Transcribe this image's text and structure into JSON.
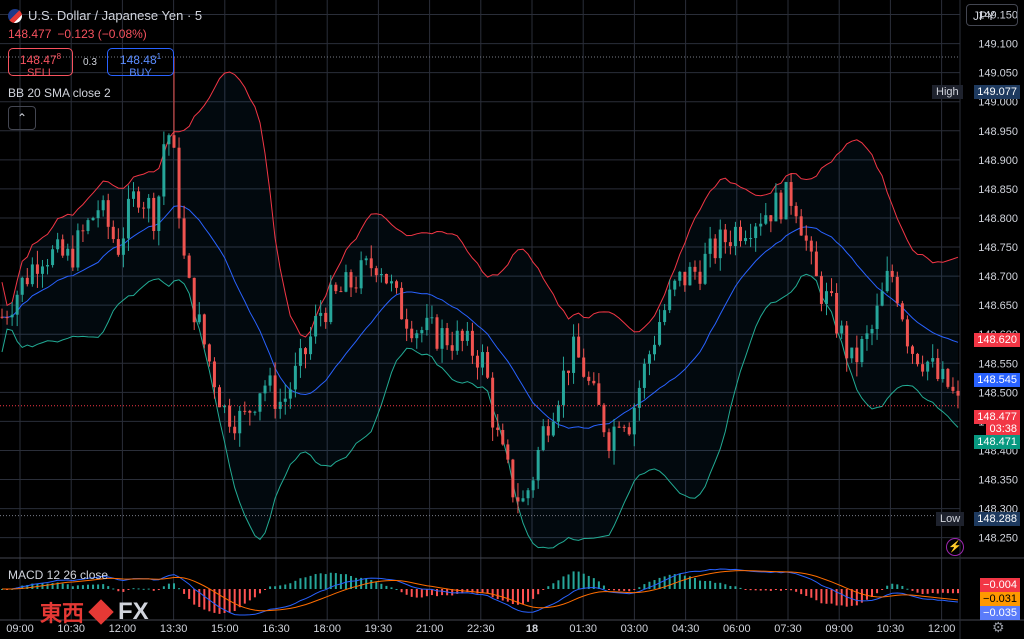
{
  "header": {
    "symbol": "U.S. Dollar / Japanese Yen · 5",
    "last": "148.477",
    "change": "−0.123 (−0.08%)",
    "sell_price_main": "148.47",
    "sell_price_sup": "8",
    "sell_label": "SELL",
    "spread": "0.3",
    "buy_price_main": "148.48",
    "buy_price_sup": "1",
    "buy_label": "BUY",
    "collapse_glyph": "⌃",
    "currency": "JPY"
  },
  "indicators": {
    "bb_label": "BB 20 SMA close 2",
    "macd_label": "MACD 12 26 close"
  },
  "icons": [
    "flag-icon",
    "chevron-up-icon",
    "bolt-icon",
    "gear-icon"
  ],
  "chart_data": {
    "type": "candlestick",
    "title": "U.S. Dollar / Japanese Yen · 5",
    "y_ticks": [
      "149.150",
      "149.100",
      "149.050",
      "149.000",
      "148.950",
      "148.900",
      "148.850",
      "148.800",
      "148.750",
      "148.700",
      "148.650",
      "148.600",
      "148.550",
      "148.500",
      "148.450",
      "148.400",
      "148.350",
      "148.300",
      "148.250"
    ],
    "ylim": [
      148.215,
      149.175
    ],
    "x_ticks": [
      "09:00",
      "10:30",
      "12:00",
      "13:30",
      "15:00",
      "16:30",
      "18:00",
      "19:30",
      "21:00",
      "22:30",
      "18",
      "01:30",
      "03:00",
      "04:30",
      "06:00",
      "07:30",
      "09:00",
      "10:30",
      "12:00"
    ],
    "close_path": [
      [
        0,
        148.63
      ],
      [
        4,
        148.74
      ],
      [
        7,
        148.73
      ],
      [
        10,
        148.82
      ],
      [
        12,
        148.75
      ],
      [
        14,
        148.85
      ],
      [
        16,
        148.8
      ],
      [
        17,
        148.97
      ],
      [
        18,
        148.88
      ],
      [
        19,
        148.7
      ],
      [
        21,
        148.58
      ],
      [
        23,
        148.47
      ],
      [
        25,
        148.45
      ],
      [
        27,
        148.52
      ],
      [
        29,
        148.48
      ],
      [
        31,
        148.55
      ],
      [
        33,
        148.64
      ],
      [
        35,
        148.67
      ],
      [
        37,
        148.7
      ],
      [
        39,
        148.73
      ],
      [
        41,
        148.65
      ],
      [
        43,
        148.61
      ],
      [
        45,
        148.6
      ],
      [
        47,
        148.59
      ],
      [
        49,
        148.57
      ],
      [
        50,
        148.55
      ],
      [
        51,
        148.44
      ],
      [
        52,
        148.38
      ],
      [
        53,
        148.33
      ],
      [
        54,
        148.31
      ],
      [
        55,
        148.36
      ],
      [
        56,
        148.43
      ],
      [
        58,
        148.52
      ],
      [
        59,
        148.57
      ],
      [
        60,
        148.55
      ],
      [
        61,
        148.5
      ],
      [
        62,
        148.46
      ],
      [
        63,
        148.42
      ],
      [
        64,
        148.47
      ],
      [
        65,
        148.45
      ],
      [
        66,
        148.51
      ],
      [
        68,
        148.62
      ],
      [
        70,
        148.69
      ],
      [
        72,
        148.71
      ],
      [
        74,
        148.75
      ],
      [
        76,
        148.78
      ],
      [
        78,
        148.8
      ],
      [
        80,
        148.82
      ],
      [
        82,
        148.84
      ],
      [
        83,
        148.78
      ],
      [
        84,
        148.7
      ],
      [
        86,
        148.64
      ],
      [
        88,
        148.55
      ],
      [
        90,
        148.6
      ],
      [
        92,
        148.71
      ],
      [
        93,
        148.66
      ],
      [
        94,
        148.58
      ],
      [
        96,
        148.55
      ],
      [
        97,
        148.52
      ],
      [
        98,
        148.51
      ],
      [
        99,
        148.477
      ]
    ],
    "high": "149.077",
    "low": "148.288",
    "current_price": "148.477",
    "countdown": "03:38",
    "bb_upper_last": "148.620",
    "bb_basis_last": "148.545",
    "bb_lower_last": "148.471",
    "high_label": "High",
    "low_label": "Low",
    "macd": {
      "macd": "−0.004",
      "signal": "−0.031",
      "hist": "−0.035"
    },
    "colors": {
      "up": "#26a69a",
      "down": "#ef5350",
      "bb_upper": "#f23645",
      "bb_basis": "#2962ff",
      "bb_lower": "#22ab94",
      "macd_line": "#2962ff",
      "signal_line": "#ff6d00"
    }
  }
}
